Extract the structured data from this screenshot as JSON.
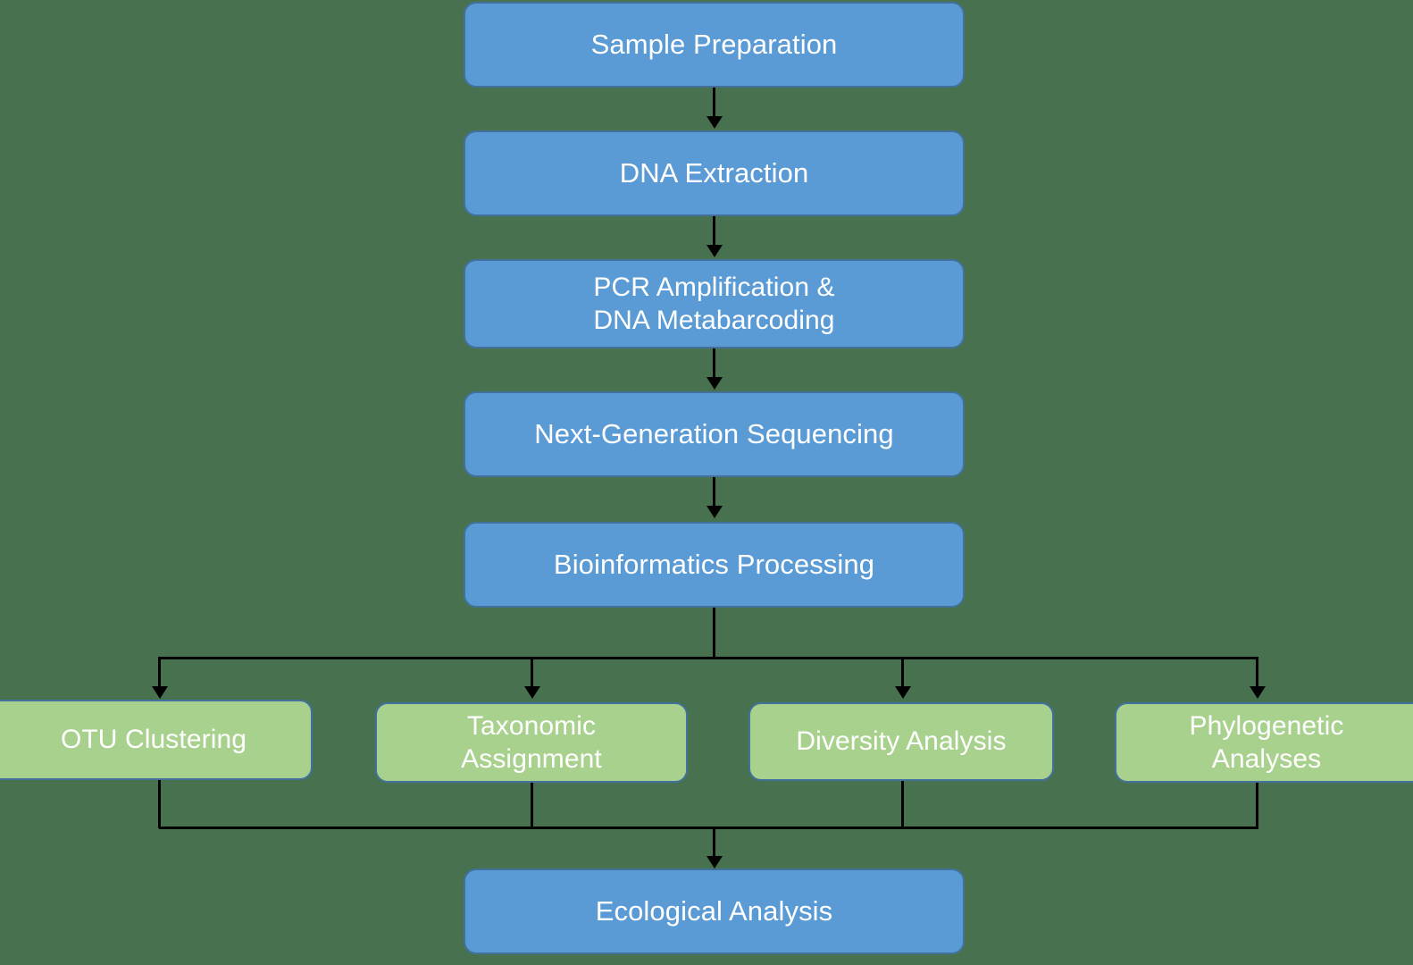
{
  "diagram": {
    "type": "flowchart",
    "orientation": "top-to-bottom",
    "background_color": "#487150",
    "colors": {
      "process_fill": "#5B9BD5",
      "branch_fill": "#A9D18E",
      "node_border": "#41719C",
      "connector": "#000000",
      "node_text": "#FFFFFF"
    }
  },
  "nodes": {
    "sample_preparation": "Sample Preparation",
    "dna_extraction": "DNA Extraction",
    "pcr_amplification": "PCR Amplification &\nDNA Metabarcoding",
    "next_generation_sequencing": "Next-Generation Sequencing",
    "bioinformatics_processing": "Bioinformatics Processing",
    "otu_clustering": "OTU Clustering",
    "taxonomic_assignment": "Taxonomic\nAssignment",
    "diversity_analysis": "Diversity Analysis",
    "phylogenetic_analyses": "Phylogenetic\nAnalyses",
    "ecological_analysis": "Ecological Analysis"
  },
  "edges": [
    {
      "from": "sample_preparation",
      "to": "dna_extraction"
    },
    {
      "from": "dna_extraction",
      "to": "pcr_amplification"
    },
    {
      "from": "pcr_amplification",
      "to": "next_generation_sequencing"
    },
    {
      "from": "next_generation_sequencing",
      "to": "bioinformatics_processing"
    },
    {
      "from": "bioinformatics_processing",
      "to": "otu_clustering"
    },
    {
      "from": "bioinformatics_processing",
      "to": "taxonomic_assignment"
    },
    {
      "from": "bioinformatics_processing",
      "to": "diversity_analysis"
    },
    {
      "from": "bioinformatics_processing",
      "to": "phylogenetic_analyses"
    },
    {
      "from": "otu_clustering",
      "to": "ecological_analysis"
    },
    {
      "from": "taxonomic_assignment",
      "to": "ecological_analysis"
    },
    {
      "from": "diversity_analysis",
      "to": "ecological_analysis"
    },
    {
      "from": "phylogenetic_analyses",
      "to": "ecological_analysis"
    }
  ]
}
